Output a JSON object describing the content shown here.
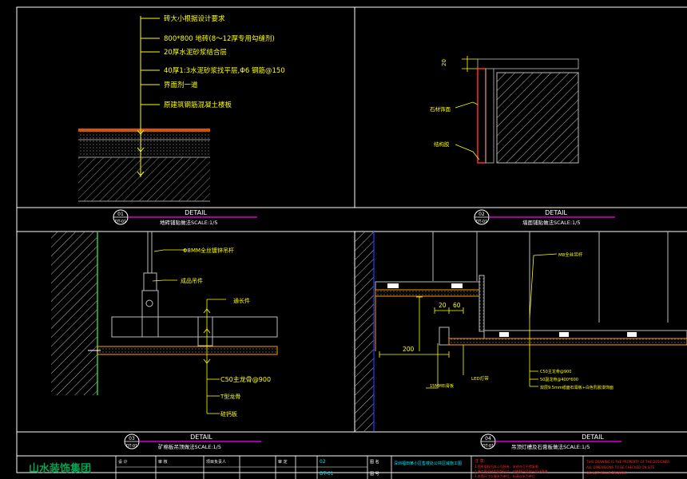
{
  "colors": {
    "background": "#000000",
    "frame": "#ffffff",
    "annotation": "#ffff00",
    "title_line": "#ff00ff",
    "detail_text": "#ffffff",
    "wall_red": "#ff2a2a",
    "hatch": "#bdbdbd",
    "cyan_text": "#00e5ff",
    "green_text": "#2ecc40",
    "logo_green": "#00a651",
    "blue_line": "#1e40ff",
    "orange": "#ff9900"
  },
  "panel1": {
    "notes": [
      "砖大小根据设计要求",
      "800*800 地砖(8～12厚专用勾缝剂)",
      "20厚水泥砂浆结合层",
      "40厚1:3水泥砂浆找平层,Φ6 钢筋@150",
      "界面剂一道",
      "原建筑钢筋混凝土楼板"
    ],
    "label_detail": "DETAIL",
    "bubble_num": "01",
    "bubble_sub": "DT-01",
    "scale_text": "地砖铺贴做法SCALE:1/5"
  },
  "panel2": {
    "notes": [
      "石材饰面",
      "结构胶"
    ],
    "dim": "20",
    "label_detail": "DETAIL",
    "bubble_num": "02",
    "bubble_sub": "DT-01",
    "scale_text": "墙面铺贴做法SCALE:1/5"
  },
  "panel3": {
    "notes": [
      "Φ8MM全丝镀锌吊杆",
      "成品吊件",
      "通长件",
      "C50主龙骨@900",
      "T型龙骨",
      "硅钙板"
    ],
    "label_detail": "DETAIL",
    "bubble_num": "03",
    "bubble_sub": "DT-01",
    "scale_text": "矿棉板吊顶做法SCALE:1/5"
  },
  "panel4": {
    "notes": [
      "M8全丝吊杆",
      "LED灯带",
      "15MM石膏板",
      "C50主龙骨@900",
      "50副龙骨@400*600",
      "双层9.5mm纸面石膏板+白色乳胶漆饰面"
    ],
    "dims": [
      "20",
      "60",
      "200"
    ],
    "label_detail": "DETAIL",
    "bubble_num": "04",
    "bubble_sub": "DT-01",
    "scale_text": "吊顶灯槽及石膏板做法SCALE:1/5"
  },
  "title_block": {
    "logo": "山水装饰集团",
    "cells": [
      "设 计",
      "审 核",
      "项目负责人",
      "审 定",
      "02",
      "DT-01",
      "图 名",
      "图 号"
    ],
    "project_text": "深圳福田某小区售楼处公共区域施工图",
    "notes_title": "注 意：",
    "notes_lines": [
      "1.图纸版权归本公司所有，未经许可不得复制",
      "2.施工前须核实现场尺寸，如有疑问及时与设计联系",
      "3.本图尺寸以毫米为单位，标高以米为单位"
    ],
    "english_lines": [
      "THIS DRAWING IS THE PROPERTY OF THE DESIGNER",
      "ALL DIMENSIONS TO BE CHECKED ON SITE",
      "DO NOT SCALE DRAWING"
    ]
  }
}
